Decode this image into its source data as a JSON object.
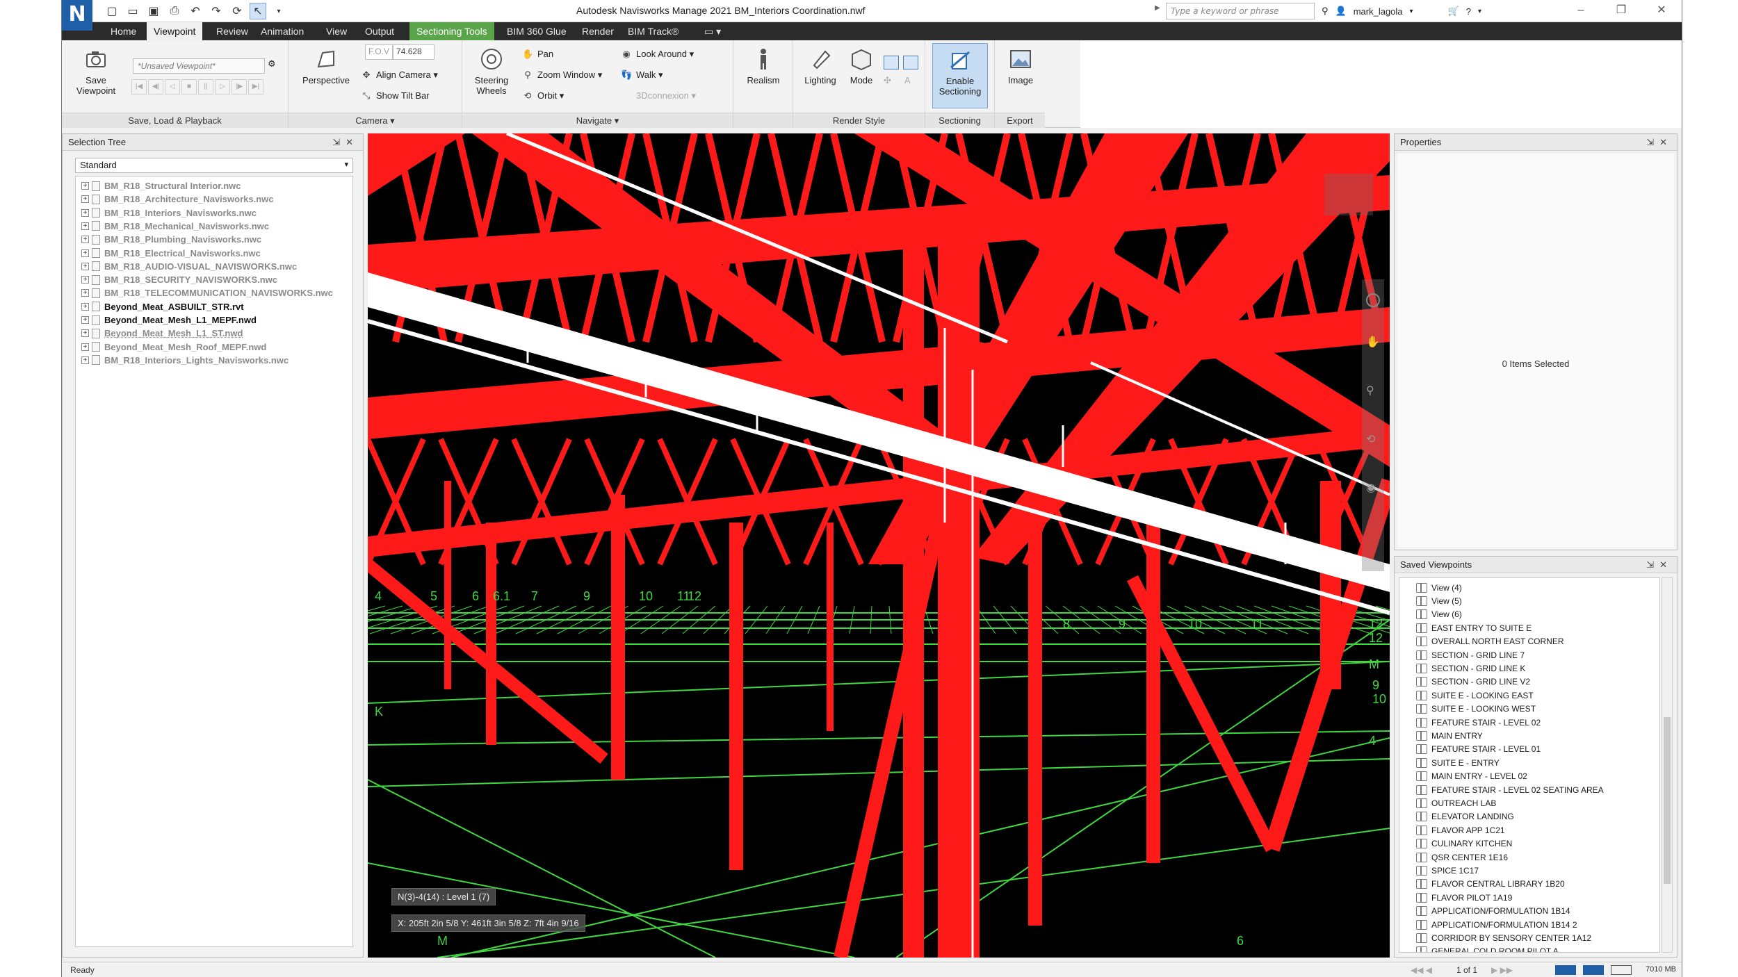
{
  "app": {
    "logo": "N",
    "title": "Autodesk Navisworks Manage 2021  BM_Interiors Coordination.nwf",
    "search_placeholder": "Type a keyword or phrase",
    "user": "mark_lagola"
  },
  "tabs": [
    "Home",
    "Viewpoint",
    "Review",
    "Animation",
    "View",
    "Output",
    "Sectioning Tools",
    "BIM 360 Glue",
    "Render",
    "BIM Track®"
  ],
  "active_tab": "Viewpoint",
  "context_tab": "Sectioning Tools",
  "ribbon": {
    "save_load": {
      "save_viewpoint": "Save\nViewpoint",
      "viewpoint_combo": "*Unsaved Viewpoint*",
      "label": "Save, Load & Playback"
    },
    "camera": {
      "perspective": "Perspective",
      "fov_label": "F.O.V",
      "fov_value": "74.628",
      "align_camera": "Align Camera",
      "show_tilt_bar": "Show Tilt Bar",
      "label": "Camera"
    },
    "navigate": {
      "steering_wheels": "Steering\nWheels",
      "pan": "Pan",
      "zoom_window": "Zoom Window",
      "orbit": "Orbit",
      "look_around": "Look Around",
      "walk": "Walk",
      "connexion": "3Dconnexion",
      "realism": "Realism",
      "label": "Navigate"
    },
    "render_style": {
      "lighting": "Lighting",
      "mode": "Mode",
      "label": "Render Style"
    },
    "sectioning": {
      "enable_sectioning": "Enable\nSectioning",
      "label": "Sectioning"
    },
    "export": {
      "image": "Image",
      "label": "Export"
    }
  },
  "selection_tree": {
    "title": "Selection Tree",
    "mode": "Standard",
    "items": [
      {
        "name": "BM_R18_Structural Interior.nwc",
        "dark": false
      },
      {
        "name": "BM_R18_Architecture_Navisworks.nwc",
        "dark": false
      },
      {
        "name": "BM_R18_Interiors_Navisworks.nwc",
        "dark": false
      },
      {
        "name": "BM_R18_Mechanical_Navisworks.nwc",
        "dark": false
      },
      {
        "name": "BM_R18_Plumbing_Navisworks.nwc",
        "dark": false
      },
      {
        "name": "BM_R18_Electrical_Navisworks.nwc",
        "dark": false
      },
      {
        "name": "BM_R18_AUDIO-VISUAL_NAVISWORKS.nwc",
        "dark": false
      },
      {
        "name": "BM_R18_SECURITY_NAVISWORKS.nwc",
        "dark": false
      },
      {
        "name": "BM_R18_TELECOMMUNICATION_NAVISWORKS.nwc",
        "dark": false
      },
      {
        "name": "Beyond_Meat_ASBUILT_STR.rvt",
        "dark": true
      },
      {
        "name": "Beyond_Meat_Mesh_L1_MEPF.nwd",
        "dark": true
      },
      {
        "name": "Beyond_Meat_Mesh_L1_ST.nwd",
        "dark": false
      },
      {
        "name": "Beyond_Meat_Mesh_Roof_MEPF.nwd",
        "dark": false
      },
      {
        "name": "BM_R18_Interiors_Lights_Navisworks.nwc",
        "dark": false
      }
    ]
  },
  "viewport": {
    "grid_label": "N(3)-4(14) : Level 1 (7)",
    "coords": "X: 205ft 2in 5/8  Y: 461ft 3in 5/8  Z: 7ft 4in 9/16",
    "grid_tags": [
      "4",
      "5",
      "6",
      "6.1",
      "7",
      "9",
      "10",
      "11",
      "12",
      "8",
      "9",
      "10",
      "11",
      "12",
      "K",
      "M",
      "M",
      "4",
      "6",
      "9",
      "10",
      "12"
    ]
  },
  "properties": {
    "title": "Properties",
    "message": "0 Items Selected"
  },
  "saved_viewpoints": {
    "title": "Saved Viewpoints",
    "items": [
      "View (4)",
      "View (5)",
      "View (6)",
      "EAST ENTRY TO SUITE E",
      "OVERALL NORTH EAST CORNER",
      "SECTION - GRID LINE 7",
      "SECTION - GRID LINE K",
      "SECTION - GRID LINE V2",
      "SUITE E - LOOKING EAST",
      "SUITE E - LOOKING WEST",
      "FEATURE STAIR - LEVEL 02",
      "MAIN ENTRY",
      "FEATURE STAIR - LEVEL 01",
      "SUITE E - ENTRY",
      "MAIN ENTRY - LEVEL 02",
      "FEATURE STAIR - LEVEL 02 SEATING AREA",
      "OUTREACH LAB",
      "ELEVATOR LANDING",
      "FLAVOR APP 1C21",
      "CULINARY KITCHEN",
      "QSR CENTER 1E16",
      "SPICE 1C17",
      "FLAVOR CENTRAL LIBRARY 1B20",
      "FLAVOR PILOT 1A19",
      "APPLICATION/FORMULATION 1B14",
      "APPLICATION/FORMULATION 1B14 2",
      "CORRIDOR BY SENSORY CENTER 1A12",
      "GENERAL COLD ROOM PILOT A"
    ]
  },
  "status": {
    "text": "Ready",
    "page": "1 of 1",
    "memory": "7010 MB"
  },
  "colors": {
    "steel": "#ff1a1a",
    "pipe": "#ffffff",
    "grid": "#3fd83f",
    "accent": "#1f5fa8"
  }
}
